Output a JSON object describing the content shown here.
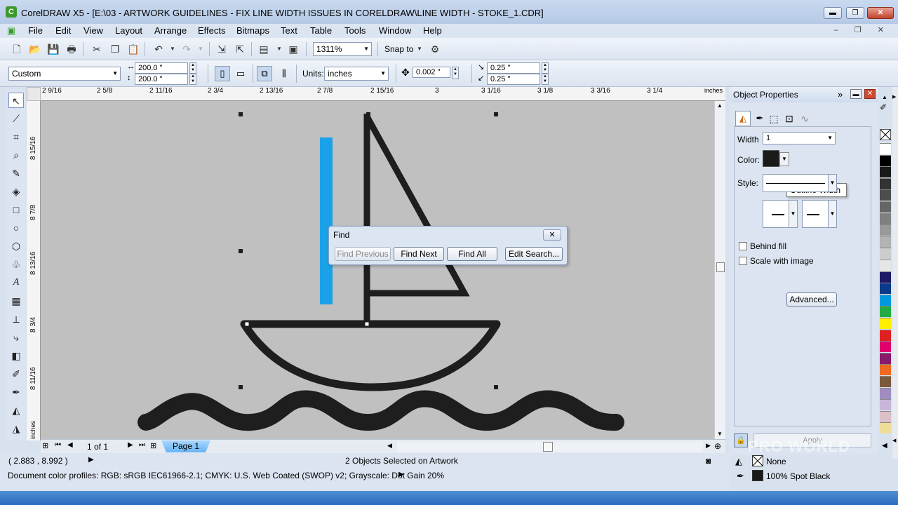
{
  "window": {
    "title": "CorelDRAW X5 - [E:\\03 - ARTWORK GUIDELINES - FIX LINE WIDTH ISSUES IN CORELDRAW\\LINE WIDTH - STOKE_1.CDR]",
    "minimize": "▬",
    "restore": "❐",
    "close": "✕"
  },
  "menu": [
    "File",
    "Edit",
    "View",
    "Layout",
    "Arrange",
    "Effects",
    "Bitmaps",
    "Text",
    "Table",
    "Tools",
    "Window",
    "Help"
  ],
  "menu_sys": "‒ ❐ ✕",
  "toolbar": {
    "zoom": "1311%",
    "snap_to": "Snap to"
  },
  "propbar": {
    "preset": "Custom",
    "width": "200.0 \"",
    "height": "200.0 \"",
    "units_label": "Units:",
    "units": "inches",
    "nudge": "0.002 \"",
    "dup_x": "0.25 \"",
    "dup_y": "0.25 \""
  },
  "ruler": {
    "h_ticks": [
      "2 9/16",
      "2 5/8",
      "2 11/16",
      "2 3/4",
      "2 13/16",
      "2 7/8",
      "2 15/16",
      "3",
      "3 1/16",
      "3 1/8",
      "3 3/16",
      "3 1/4"
    ],
    "h_unit": "inches",
    "v_ticks": [
      "8 15/16",
      "8 7/8",
      "8 13/16",
      "8 3/4",
      "8 11/16"
    ],
    "v_unit": "inches"
  },
  "page_nav": {
    "count": "1 of 1",
    "tab": "Page 1"
  },
  "find_dialog": {
    "title": "Find",
    "close": "✕",
    "find_previous": "Find Previous",
    "find_next": "Find Next",
    "find_all": "Find All",
    "edit_search": "Edit Search..."
  },
  "status": {
    "coords": "( 2.883 , 8.992 )",
    "selection": "2 Objects Selected on Artwork",
    "profiles": "Document color profiles: RGB: sRGB IEC61966-2.1; CMYK: U.S. Web Coated (SWOP) v2; Grayscale: Dot Gain 20%",
    "fill_name": "None",
    "outline_name": "100% Spot Black"
  },
  "docker": {
    "title": "Object Properties",
    "width_label": "Width",
    "width_value": "1",
    "tooltip": "Outline Width",
    "color_label": "Color:",
    "style_label": "Style:",
    "behind_fill": "Behind fill",
    "scale_with_image": "Scale with image",
    "advanced": "Advanced...",
    "apply": "Apply"
  },
  "colors": {
    "accent_blue": "#1ba1e8",
    "boat": "#1e1e1e",
    "canvas": "#c0c0c0",
    "palette": [
      "#ffffff",
      "#000000",
      "#1a1a1a",
      "#333333",
      "#4d4d4d",
      "#666666",
      "#808080",
      "#999999",
      "#b3b3b3",
      "#cccccc",
      "#e6e6e6",
      "#1f1a66",
      "#0a3a8a",
      "#0099dd",
      "#22aa44",
      "#ffee00",
      "#e02020",
      "#e0006e",
      "#8a1a6a",
      "#ee6a20",
      "#7a5a3a",
      "#a08cc0",
      "#c8b6d8",
      "#dcc0c8",
      "#eedd99"
    ]
  },
  "watermark": "PRO WORLD"
}
